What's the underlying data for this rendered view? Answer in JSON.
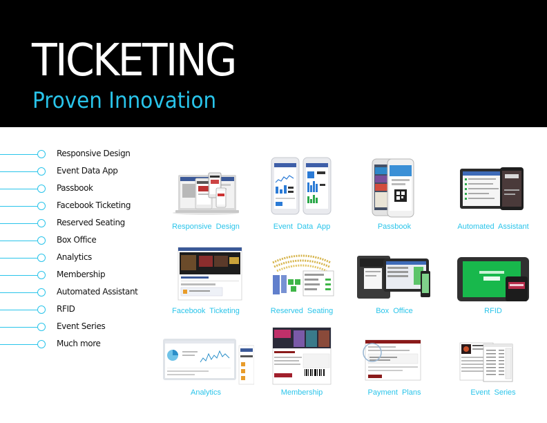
{
  "header": {
    "title": "TICKETING",
    "subtitle": "Proven Innovation"
  },
  "colors": {
    "accent": "#29c4ea",
    "header_bg": "#000000",
    "text": "#111111"
  },
  "features": [
    "Responsive Design",
    "Event Data App",
    "Passbook",
    "Facebook Ticketing",
    "Reserved Seating",
    "Box Office",
    "Analytics",
    "Membership",
    "Automated Assistant",
    "RFID",
    "Event Series",
    "Much more"
  ],
  "gallery": [
    {
      "caption": "Responsive Design",
      "image": "responsive-devices-image"
    },
    {
      "caption": "Event Data App",
      "image": "event-data-app-phones-image"
    },
    {
      "caption": "Passbook",
      "image": "passbook-phone-image"
    },
    {
      "caption": "Automated Assistant",
      "image": "automated-assistant-devices-image"
    },
    {
      "caption": "Facebook Ticketing",
      "image": "facebook-ticketing-screenshot-image"
    },
    {
      "caption": "Reserved Seating",
      "image": "reserved-seating-map-image"
    },
    {
      "caption": "Box Office",
      "image": "box-office-printer-image"
    },
    {
      "caption": "RFID",
      "image": "rfid-tablet-image"
    },
    {
      "caption": "Analytics",
      "image": "analytics-dashboard-image"
    },
    {
      "caption": "Membership",
      "image": "membership-card-image"
    },
    {
      "caption": "Payment Plans",
      "image": "payment-plans-screenshot-image"
    },
    {
      "caption": "Event Series",
      "image": "event-series-screenshot-image"
    }
  ]
}
